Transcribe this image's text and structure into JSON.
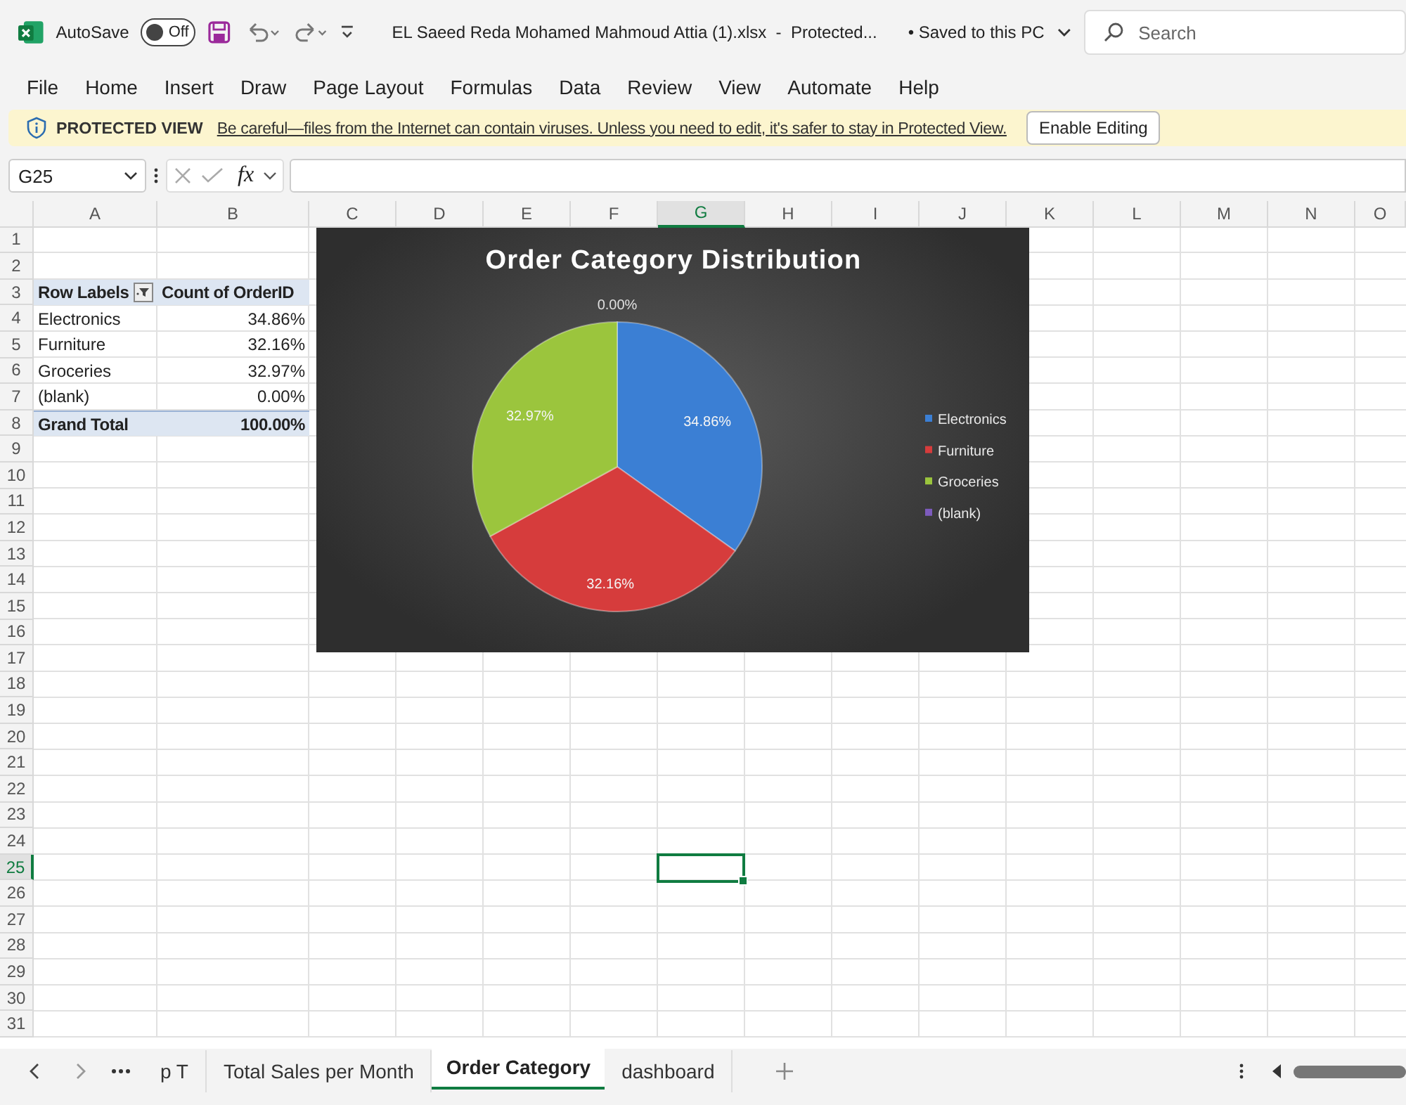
{
  "title_bar": {
    "autosave_label": "AutoSave",
    "autosave_on": false,
    "autosave_state": "Off",
    "filename": "EL Saeed Reda Mohamed Mahmoud Attia (1).xlsx  -  Protected...",
    "save_status": "• Saved to this PC",
    "search_placeholder": "Search"
  },
  "menu": [
    "File",
    "Home",
    "Insert",
    "Draw",
    "Page Layout",
    "Formulas",
    "Data",
    "Review",
    "View",
    "Automate",
    "Help"
  ],
  "protected_view": {
    "label": "PROTECTED VIEW",
    "message": "Be careful—files from the Internet can contain viruses. Unless you need to edit, it's safer to stay in Protected View.",
    "button": "Enable Editing"
  },
  "formula_bar": {
    "name_box": "G25",
    "function_label": "fx"
  },
  "columns": [
    {
      "label": "A",
      "selected": false
    },
    {
      "label": "B",
      "selected": false
    },
    {
      "label": "C",
      "selected": false
    },
    {
      "label": "D",
      "selected": false
    },
    {
      "label": "E",
      "selected": false
    },
    {
      "label": "F",
      "selected": false
    },
    {
      "label": "G",
      "selected": true
    },
    {
      "label": "H",
      "selected": false
    },
    {
      "label": "I",
      "selected": false
    },
    {
      "label": "J",
      "selected": false
    },
    {
      "label": "K",
      "selected": false
    },
    {
      "label": "L",
      "selected": false
    },
    {
      "label": "M",
      "selected": false
    },
    {
      "label": "N",
      "selected": false
    },
    {
      "label": "O",
      "selected": false
    }
  ],
  "rows": [
    {
      "label": "1",
      "selected": false
    },
    {
      "label": "2",
      "selected": false
    },
    {
      "label": "3",
      "selected": false
    },
    {
      "label": "4",
      "selected": false
    },
    {
      "label": "5",
      "selected": false
    },
    {
      "label": "6",
      "selected": false
    },
    {
      "label": "7",
      "selected": false
    },
    {
      "label": "8",
      "selected": false
    },
    {
      "label": "9",
      "selected": false
    },
    {
      "label": "10",
      "selected": false
    },
    {
      "label": "11",
      "selected": false
    },
    {
      "label": "12",
      "selected": false
    },
    {
      "label": "13",
      "selected": false
    },
    {
      "label": "14",
      "selected": false
    },
    {
      "label": "15",
      "selected": false
    },
    {
      "label": "16",
      "selected": false
    },
    {
      "label": "17",
      "selected": false
    },
    {
      "label": "18",
      "selected": false
    },
    {
      "label": "19",
      "selected": false
    },
    {
      "label": "20",
      "selected": false
    },
    {
      "label": "21",
      "selected": false
    },
    {
      "label": "22",
      "selected": false
    },
    {
      "label": "23",
      "selected": false
    },
    {
      "label": "24",
      "selected": false
    },
    {
      "label": "25",
      "selected": true
    },
    {
      "label": "26",
      "selected": false
    },
    {
      "label": "27",
      "selected": false
    },
    {
      "label": "28",
      "selected": false
    },
    {
      "label": "29",
      "selected": false
    },
    {
      "label": "30",
      "selected": false
    },
    {
      "label": "31",
      "selected": false
    }
  ],
  "pivot": {
    "headers": [
      "Row Labels",
      "Count of OrderID"
    ],
    "rows": [
      {
        "label": "Electronics",
        "value": "34.86%"
      },
      {
        "label": "Furniture",
        "value": "32.16%"
      },
      {
        "label": "Groceries",
        "value": "32.97%"
      },
      {
        "label": "(blank)",
        "value": "0.00%"
      }
    ],
    "total": {
      "label": "Grand Total",
      "value": "100.00%"
    }
  },
  "chart": {
    "chart_data": {
      "type": "pie",
      "title": "Order Category Distribution",
      "categories": [
        "Electronics",
        "Furniture",
        "Groceries",
        "(blank)"
      ],
      "values": [
        34.86,
        32.16,
        32.97,
        0
      ],
      "colors": [
        "#3b7fd4",
        "#d63c3c",
        "#9bc53d",
        "#7d5bbd"
      ],
      "value_labels": [
        "34.86%",
        "32.16%",
        "32.97%",
        "0.00%"
      ],
      "legend": true
    }
  },
  "sheet_tabs": [
    {
      "label": "p T",
      "selected": false
    },
    {
      "label": "Total Sales per Month",
      "selected": false
    },
    {
      "label": "Order Category",
      "selected": true
    },
    {
      "label": "dashboard",
      "selected": false
    }
  ]
}
